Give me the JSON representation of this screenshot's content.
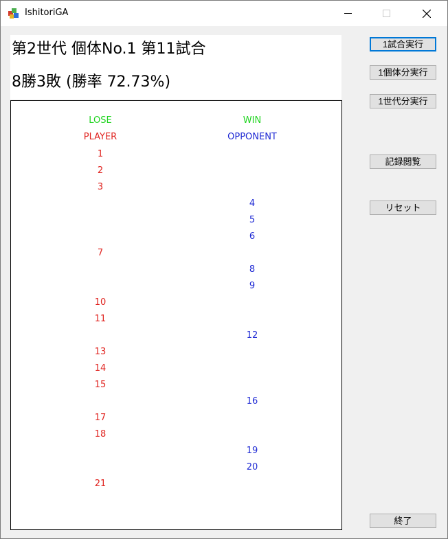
{
  "window": {
    "title": "IshitoriGA"
  },
  "header": {
    "line1": "第2世代 個体No.1 第11試合",
    "line2": "8勝3敗 (勝率 72.73%)"
  },
  "board": {
    "left_result": "LOSE",
    "right_result": "WIN",
    "left_label": "PLAYER",
    "right_label": "OPPONENT",
    "moves": [
      {
        "n": "1",
        "side": "player"
      },
      {
        "n": "2",
        "side": "player"
      },
      {
        "n": "3",
        "side": "player"
      },
      {
        "n": "4",
        "side": "opponent"
      },
      {
        "n": "5",
        "side": "opponent"
      },
      {
        "n": "6",
        "side": "opponent"
      },
      {
        "n": "7",
        "side": "player"
      },
      {
        "n": "8",
        "side": "opponent"
      },
      {
        "n": "9",
        "side": "opponent"
      },
      {
        "n": "10",
        "side": "player"
      },
      {
        "n": "11",
        "side": "player"
      },
      {
        "n": "12",
        "side": "opponent"
      },
      {
        "n": "13",
        "side": "player"
      },
      {
        "n": "14",
        "side": "player"
      },
      {
        "n": "15",
        "side": "player"
      },
      {
        "n": "16",
        "side": "opponent"
      },
      {
        "n": "17",
        "side": "player"
      },
      {
        "n": "18",
        "side": "player"
      },
      {
        "n": "19",
        "side": "opponent"
      },
      {
        "n": "20",
        "side": "opponent"
      },
      {
        "n": "21",
        "side": "player"
      }
    ]
  },
  "buttons": {
    "run_one_match": "1試合実行",
    "run_one_individual": "1個体分実行",
    "run_one_generation": "1世代分実行",
    "view_records": "記録閲覧",
    "reset": "リセット",
    "exit": "終了"
  },
  "colors": {
    "player": "#e0231f",
    "opponent": "#1f2ad4",
    "result": "#1ed41e"
  }
}
